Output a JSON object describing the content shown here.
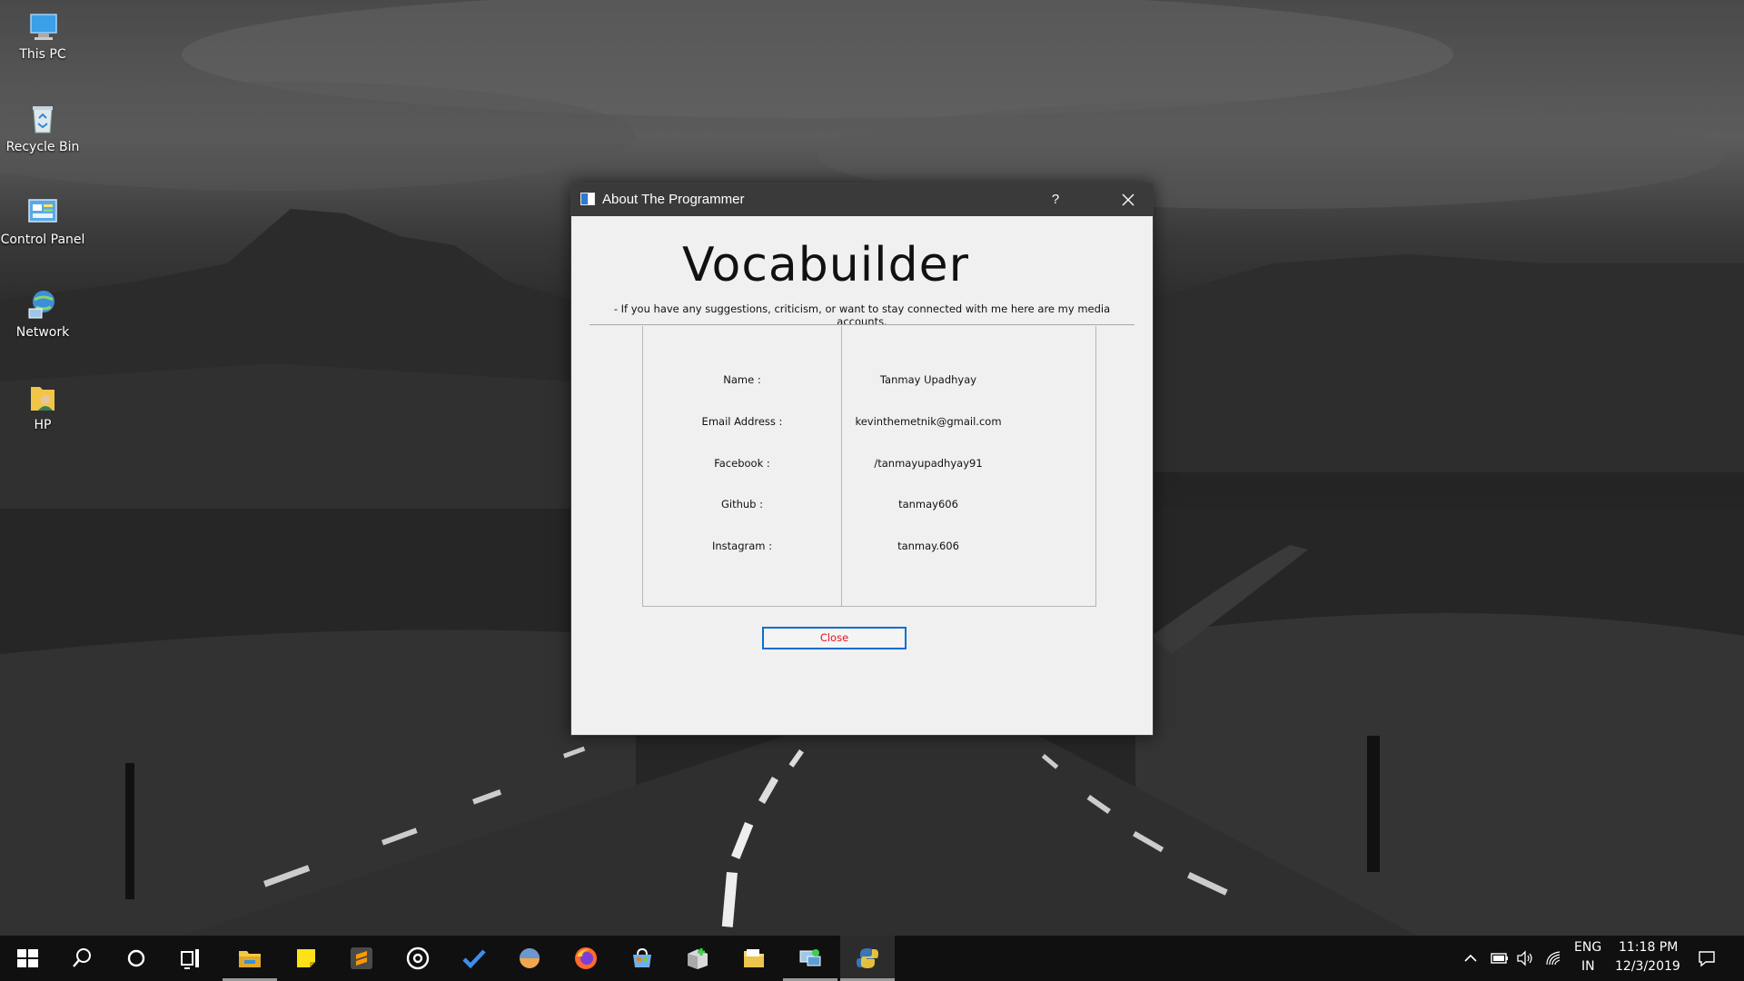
{
  "desktop": {
    "icons": [
      {
        "label": "This PC",
        "icon": "computer-icon"
      },
      {
        "label": "Recycle Bin",
        "icon": "recycle-bin-icon"
      },
      {
        "label": "Control Panel",
        "icon": "control-panel-icon"
      },
      {
        "label": "Network",
        "icon": "network-icon"
      },
      {
        "label": "HP",
        "icon": "user-folder-icon"
      }
    ]
  },
  "dialog": {
    "window_title": "About The Programmer",
    "help_label": "?",
    "app_title": "Vocabuilder",
    "subtitle": "- If you have any suggestions, criticism, or want to stay connected with me here are my media accounts.",
    "fields": [
      {
        "label": "Name :",
        "value": "Tanmay Upadhyay"
      },
      {
        "label": "Email Address :",
        "value": "kevinthemetnik@gmail.com"
      },
      {
        "label": "Facebook :",
        "value": "/tanmayupadhyay91"
      },
      {
        "label": "Github :",
        "value": "tanmay606"
      },
      {
        "label": "Instagram :",
        "value": "tanmay.606"
      }
    ],
    "close_button_label": "Close",
    "colors": {
      "close_text": "#e81123",
      "button_border": "#0b6ed0",
      "titlebar": "#3a3a3a"
    }
  },
  "taskbar": {
    "apps": [
      "start-icon",
      "search-icon",
      "cortana-icon",
      "task-view-icon",
      "file-explorer-icon",
      "sticky-notes-icon",
      "sublime-text-icon",
      "groove-music-icon",
      "todo-icon",
      "blender-icon",
      "firefox-icon",
      "store-icon",
      "app-installer-icon",
      "file-manager-icon",
      "network-settings-icon",
      "python-icon"
    ],
    "tray": {
      "language_top": "ENG",
      "language_bottom": "IN",
      "time": "11:18 PM",
      "date": "12/3/2019"
    }
  }
}
